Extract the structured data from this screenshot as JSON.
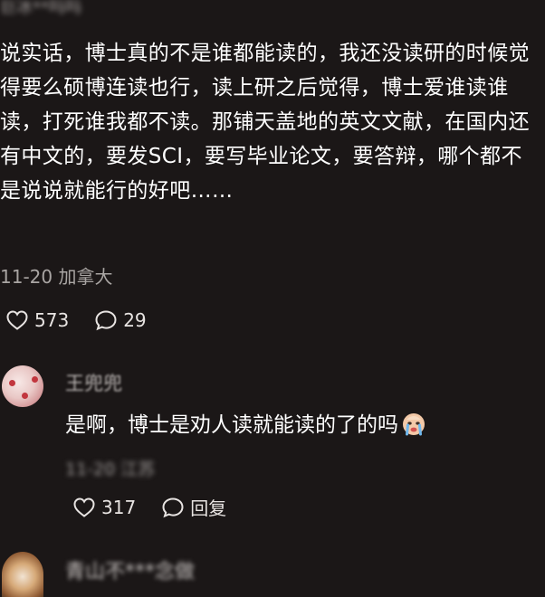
{
  "top_comment": {
    "author_name": "巨冰**吗吗",
    "text": "说实话，博士真的不是谁都能读的，我还没读研的时候觉得要么硕博连读也行，读上研之后觉得，博士爱谁读谁读，打死谁我都不读。那铺天盖地的英文文献，在国内还有中文的，要发SCI，要写毕业论文，要答辩，哪个都不是说说就能行的好吧……",
    "date": "11-20",
    "location": "加拿大",
    "like_count": "573",
    "comment_count": "29"
  },
  "reply": {
    "author_name": "王兜兜",
    "text": "是啊，博士是劝人读就能读的了的吗",
    "emoji": "crying-face-emoji",
    "meta": "11-20 江苏",
    "like_count": "317",
    "reply_label": "回复"
  },
  "next_comment": {
    "author_name": "青山不***念做"
  },
  "colors": {
    "background": "#1b1717",
    "text": "#ffffff",
    "muted": "#a9a5a3"
  }
}
